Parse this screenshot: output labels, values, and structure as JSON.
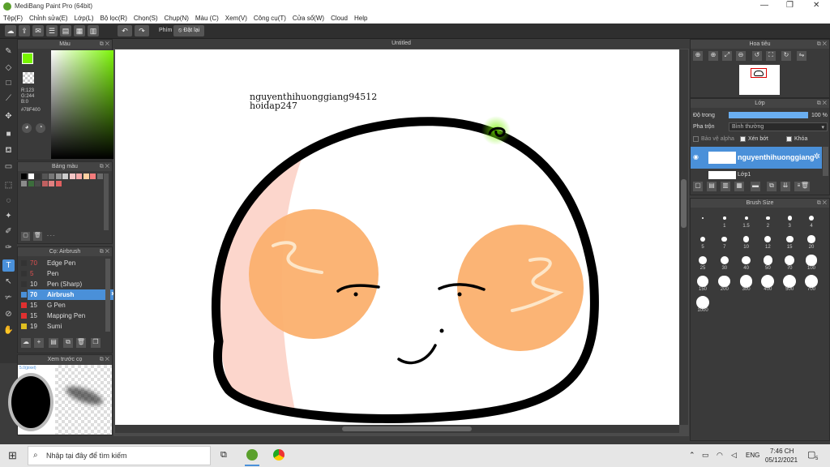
{
  "window": {
    "title": "MediBang Paint Pro (64bit)"
  },
  "menu": [
    "Tệp(F)",
    "Chỉnh sửa(E)",
    "Lớp(L)",
    "Bộ lọc(R)",
    "Chọn(S)",
    "Chụp(N)",
    "Màu (C)",
    "Xem(V)",
    "Công cụ(T)",
    "Cửa sổ(W)",
    "Cloud",
    "Help"
  ],
  "toolbar": {
    "label_phim": "Phím",
    "reset_label": "Đặt lại"
  },
  "color_panel": {
    "title": "Màu",
    "rgb_r": "R:123",
    "rgb_g": "G:244",
    "rgb_b": "B:0",
    "hex": "#78F400",
    "fg_color": "#78f400"
  },
  "palette_panel": {
    "title": "Bảng màu",
    "footer": "- - -",
    "swatches": [
      "#000000",
      "#ffffff",
      "#333333",
      "#555555",
      "#777777",
      "#999999",
      "#cccccc",
      "#f4c6c6",
      "#f7a9a9",
      "#ffd0a0",
      "#f47c7c",
      "#6b6b6b",
      "#8b8b8b",
      "#3c6d3c",
      "#4a4a4a",
      "#c06060",
      "#e08080",
      "#e06060"
    ]
  },
  "brush_panel": {
    "title": "Cọ: Airbrush",
    "items": [
      {
        "num": "70",
        "name": "Edge Pen",
        "color": "#333333"
      },
      {
        "num": "5",
        "name": "Pen",
        "color": "#333333"
      },
      {
        "num": "10",
        "name": "Pen (Sharp)",
        "color": "#333333"
      },
      {
        "num": "70",
        "name": "Airbrush",
        "color": "#4a90d9"
      },
      {
        "num": "15",
        "name": "G Pen",
        "color": "#e03030"
      },
      {
        "num": "15",
        "name": "Mapping Pen",
        "color": "#e03030"
      },
      {
        "num": "19",
        "name": "Sumi",
        "color": "#e0c020"
      }
    ]
  },
  "preview_panel": {
    "title": "Xem trước cọ",
    "size_label": "5.0(pixel)"
  },
  "document": {
    "title": "Untitled",
    "watermark_line1": "nguyenthihuonggiang94512",
    "watermark_line2": "hoidap247"
  },
  "navigator_panel": {
    "title": "Hoa tiêu"
  },
  "layer_panel": {
    "title": "Lớp",
    "opacity_label": "Độ trong",
    "opacity_value": "100 %",
    "opacity": 1.0,
    "blend_label": "Pha trộn",
    "blend_value": "Bình thường",
    "protect_alpha": "Bảo vệ alpha",
    "clipping": "Xén bớt",
    "lock": "Khóa",
    "layer_name": "nguyenthihuonggiang",
    "layer2_name": "Lớp1"
  },
  "brush_size_panel": {
    "title": "Brush Size",
    "sizes": [
      "",
      "1",
      "1.5",
      "2",
      "3",
      "4",
      "5",
      "7",
      "10",
      "12",
      "15",
      "20",
      "25",
      "30",
      "40",
      "50",
      "70",
      "100",
      "150",
      "200",
      "300",
      "400",
      "500",
      "700",
      "1000"
    ]
  },
  "taskbar": {
    "search_placeholder": "Nhập tại đây để tìm kiếm",
    "time": "7:46 CH",
    "date": "05/12/2021",
    "lang": "ENG",
    "notif_count": "5"
  }
}
